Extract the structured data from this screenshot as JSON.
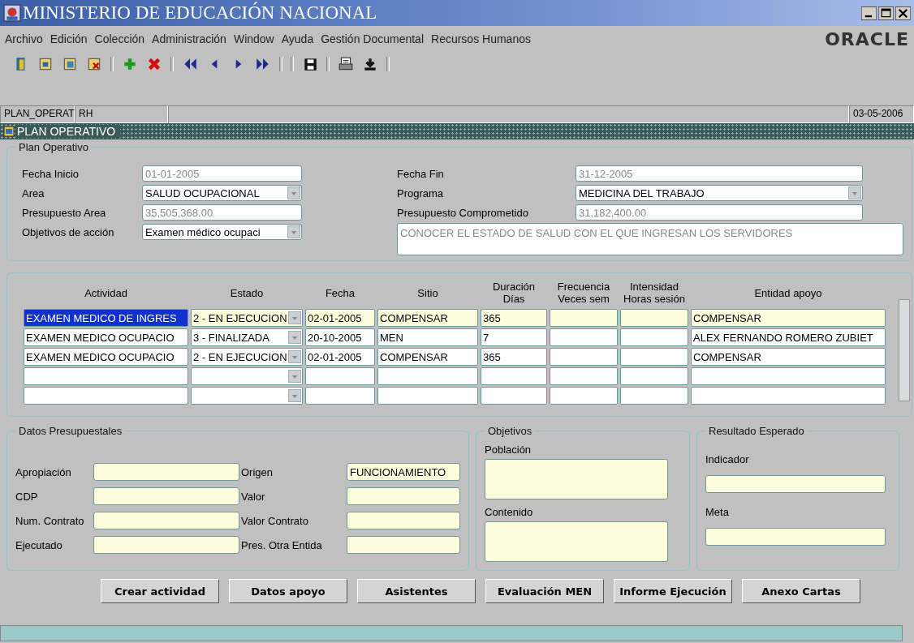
{
  "window": {
    "title": "MINISTERIO DE EDUCACIÓN NACIONAL"
  },
  "menu": [
    {
      "label": "Archivo"
    },
    {
      "label": "Edición"
    },
    {
      "label": "Colección"
    },
    {
      "label": "Administración"
    },
    {
      "label": "Window"
    },
    {
      "label": "Ayuda"
    },
    {
      "label": "Gestión Documental"
    },
    {
      "label": "Recursos Humanos"
    }
  ],
  "logo": "ORACLE",
  "status_bar": [
    {
      "text": "PLAN_OPERAT"
    },
    {
      "text": "RH"
    },
    {
      "text": "03-05-2006"
    }
  ],
  "form": {
    "title": "PLAN OPERATIVO",
    "plan": {
      "title": "Plan Operativo",
      "fields": [
        {
          "label": "Fecha Inicio",
          "value": "01-01-2005",
          "kind": "text",
          "readonly": true
        },
        {
          "label": "Fecha Fin",
          "value": "31-12-2005",
          "kind": "text",
          "readonly": true
        },
        {
          "label": "Area",
          "value": "SALUD OCUPACIONAL",
          "kind": "select",
          "readonly": false
        },
        {
          "label": "Programa",
          "value": "MEDICINA DEL TRABAJO",
          "kind": "select",
          "readonly": false
        },
        {
          "label": "Presupuesto Area",
          "value": "35,505,368.00",
          "kind": "text",
          "readonly": true
        },
        {
          "label": "Presupuesto Comprometido",
          "value": "31,182,400.00",
          "kind": "text",
          "readonly": true
        },
        {
          "label": "Objetivos de acción",
          "value": "Examen médico ocupaci",
          "kind": "select",
          "readonly": false
        },
        {
          "value": "CONOCER EL ESTADO DE SALUD CON EL QUE INGRESAN LOS SERVIDORES",
          "kind": "textarea",
          "readonly": true
        }
      ]
    },
    "table": {
      "columns": [
        "Actividad",
        "Estado",
        "Fecha",
        "Sitio",
        "Duración Días",
        "Frecuencia Veces sem",
        "Intensidad Horas sesión",
        "Entidad apoyo"
      ],
      "rows": [
        {
          "current": true,
          "actividad": "EXAMEN MEDICO DE INGRES",
          "estado": "2 - EN EJECUCION",
          "fecha": "02-01-2005",
          "sitio": "COMPENSAR",
          "duracion": "365",
          "entidad": "COMPENSAR"
        },
        {
          "current": false,
          "actividad": "EXAMEN MEDICO OCUPACIO",
          "estado": "3 - FINALIZADA",
          "fecha": "20-10-2005",
          "sitio": "MEN",
          "duracion": "7",
          "entidad": "ALEX FERNANDO ROMERO ZUBIET"
        },
        {
          "current": false,
          "actividad": "EXAMEN MEDICO OCUPACIO",
          "estado": "2 - EN EJECUCION",
          "fecha": "02-01-2005",
          "sitio": "COMPENSAR",
          "duracion": "365",
          "entidad": "COMPENSAR"
        },
        {
          "current": false
        },
        {
          "current": false
        }
      ]
    },
    "presupuesto": {
      "title": "Datos Presupuestales",
      "fields": [
        {
          "label": "Apropiación"
        },
        {
          "label": "Origen",
          "value": "FUNCIONAMIENTO"
        },
        {
          "label": "CDP"
        },
        {
          "label": "Valor"
        },
        {
          "label": "Num. Contrato"
        },
        {
          "label": "Valor Contrato"
        },
        {
          "label": "Ejecutado"
        },
        {
          "label": "Pres. Otra Entida"
        }
      ]
    },
    "objetivos": {
      "title": "Objetivos",
      "fields": [
        {
          "label": "Población"
        },
        {
          "label": "Contenido"
        }
      ]
    },
    "resultado": {
      "title": "Resultado Esperado",
      "fields": [
        {
          "label": "Indicador"
        },
        {
          "label": "Meta"
        }
      ]
    },
    "buttons": [
      "Crear actividad",
      "Datos apoyo",
      "Asistentes",
      "Evaluación MEN",
      "Informe Ejecución",
      "Anexo Cartas"
    ]
  }
}
